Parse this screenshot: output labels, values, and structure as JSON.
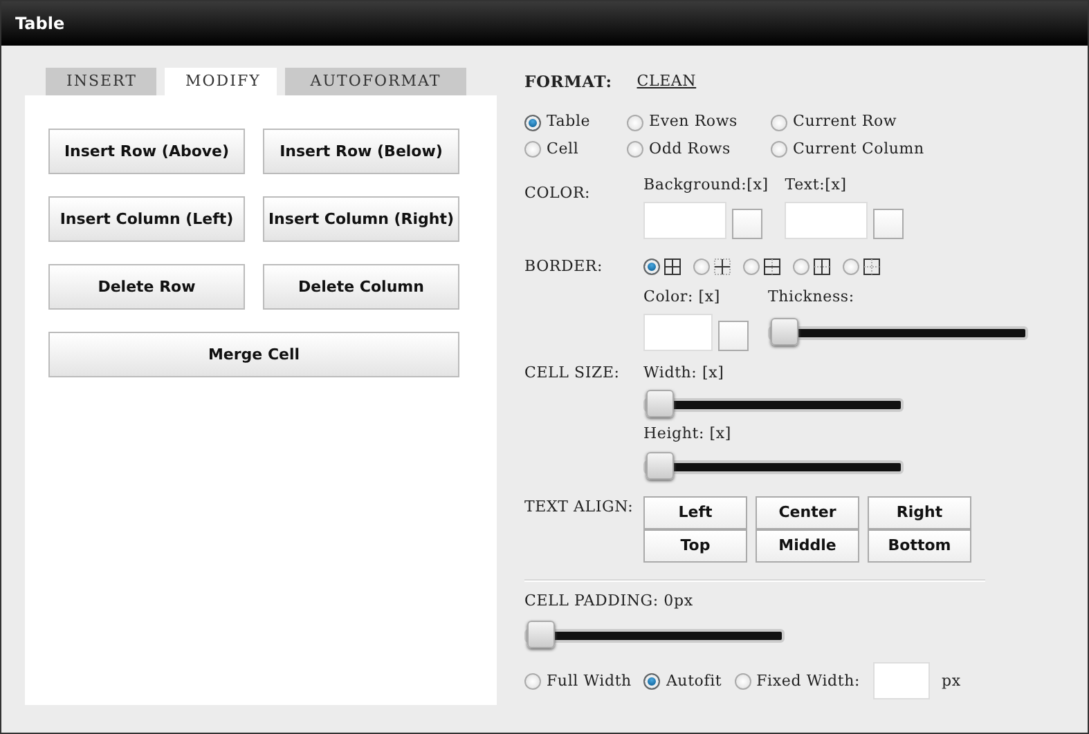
{
  "window": {
    "title": "Table"
  },
  "tabs": [
    {
      "label": "INSERT",
      "selected": false
    },
    {
      "label": "MODIFY",
      "selected": true
    },
    {
      "label": "AUTOFORMAT",
      "selected": false
    }
  ],
  "actions": [
    "Insert Row (Above)",
    "Insert Row (Below)",
    "Insert Column (Left)",
    "Insert Column (Right)",
    "Delete Row",
    "Delete Column"
  ],
  "merge_button": "Merge Cell",
  "format": {
    "label": "FORMAT:",
    "link": "CLEAN",
    "scopes": [
      {
        "label": "Table",
        "selected": true
      },
      {
        "label": "Even Rows",
        "selected": false
      },
      {
        "label": "Current Row",
        "selected": false
      },
      {
        "label": "Cell",
        "selected": false
      },
      {
        "label": "Odd Rows",
        "selected": false
      },
      {
        "label": "Current Column",
        "selected": false
      }
    ]
  },
  "color": {
    "label": "COLOR:",
    "fields": [
      {
        "label": "Background:[x]"
      },
      {
        "label": "Text:[x]"
      }
    ]
  },
  "border": {
    "label": "BORDER:",
    "styles": [
      {
        "kind": "all",
        "selected": true
      },
      {
        "kind": "inner",
        "selected": false
      },
      {
        "kind": "horizontal",
        "selected": false
      },
      {
        "kind": "vertical",
        "selected": false
      },
      {
        "kind": "outer",
        "selected": false
      }
    ],
    "color_label": "Color: [x]",
    "thickness": {
      "label": "Thickness:",
      "level": 0
    }
  },
  "cell_size": {
    "label": "CELL SIZE:",
    "width": {
      "label": "Width: [x]",
      "level": 0
    },
    "height": {
      "label": "Height: [x]",
      "level": 0
    }
  },
  "text_align": {
    "label": "TEXT ALIGN:",
    "buttons": [
      "Left",
      "Center",
      "Right",
      "Top",
      "Middle",
      "Bottom"
    ]
  },
  "cell_padding": {
    "label": "CELL PADDING: 0px",
    "level": 0
  },
  "width_mode": {
    "options": [
      {
        "label": "Full Width",
        "selected": false
      },
      {
        "label": "Autofit",
        "selected": true
      },
      {
        "label": "Fixed Width:",
        "selected": false
      }
    ],
    "unit": "px"
  }
}
